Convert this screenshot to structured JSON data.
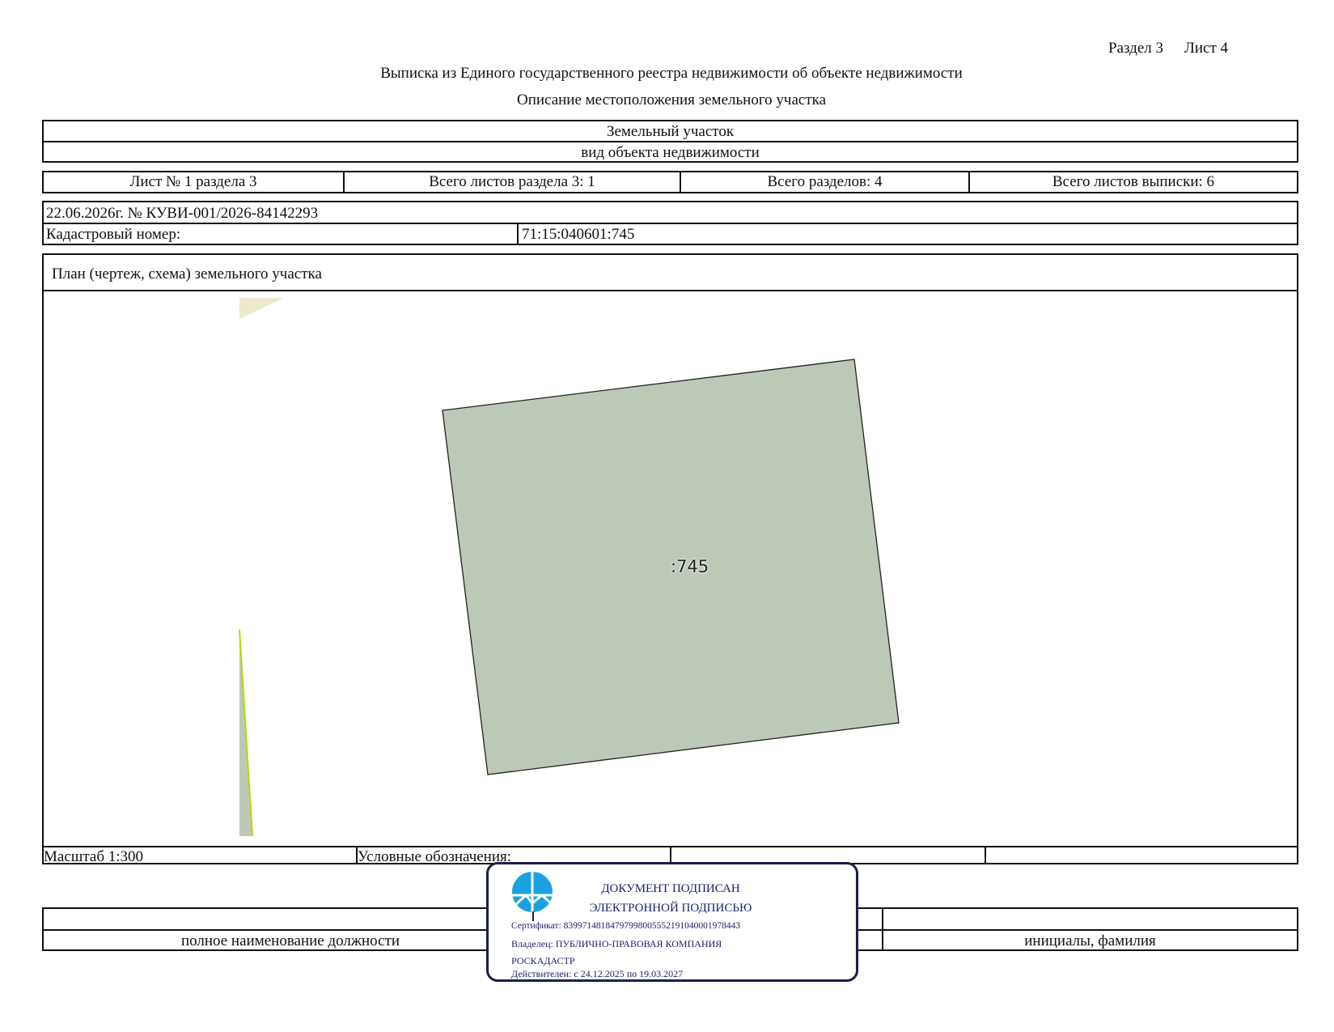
{
  "header": {
    "section": "Раздел 3",
    "sheet": "Лист 4",
    "title": "Выписка из Единого государственного реестра недвижимости об объекте недвижимости",
    "subtitle": "Описание местоположения земельного участка"
  },
  "object": {
    "type_value": "Земельный участок",
    "type_caption": "вид объекта недвижимости"
  },
  "sheets_info": {
    "sheet_no": "Лист № 1 раздела 3",
    "total_section_sheets": "Всего листов раздела 3: 1",
    "total_sections": "Всего разделов: 4",
    "total_extract_sheets": "Всего листов выписки: 6"
  },
  "record": {
    "date_number": "22.06.2026г. № КУВИ-001/2026-84142293",
    "cadastral_label": "Кадастровый номер:",
    "cadastral_value": "71:15:040601:745"
  },
  "plan": {
    "title": "План (чертеж, схема) земельного участка",
    "parcel_label": ":745",
    "parcel_fill": "#bdc9b7",
    "neighbor_fill": "#ece9cf",
    "scale": "Масштаб 1:300",
    "legend_label": "Условные обозначения:"
  },
  "signature": {
    "position_caption": "полное наименование должности",
    "name_caption": "инициалы, фамилия"
  },
  "stamp": {
    "line1": "ДОКУМЕНТ ПОДПИСАН",
    "line2": "ЭЛЕКТРОННОЙ ПОДПИСЬЮ",
    "certificate": "Сертификат: 83997148184797998005552191040001978443",
    "owner": "Владелец: ПУБЛИЧНО-ПРАВОВАЯ КОМПАНИЯ",
    "owner2": "РОСКАДАСТР",
    "valid": "Действителен: с 24.12.2025 по 19.03.2027",
    "border_color": "#1a1f4d",
    "logo_color": "#1aa3e0"
  }
}
